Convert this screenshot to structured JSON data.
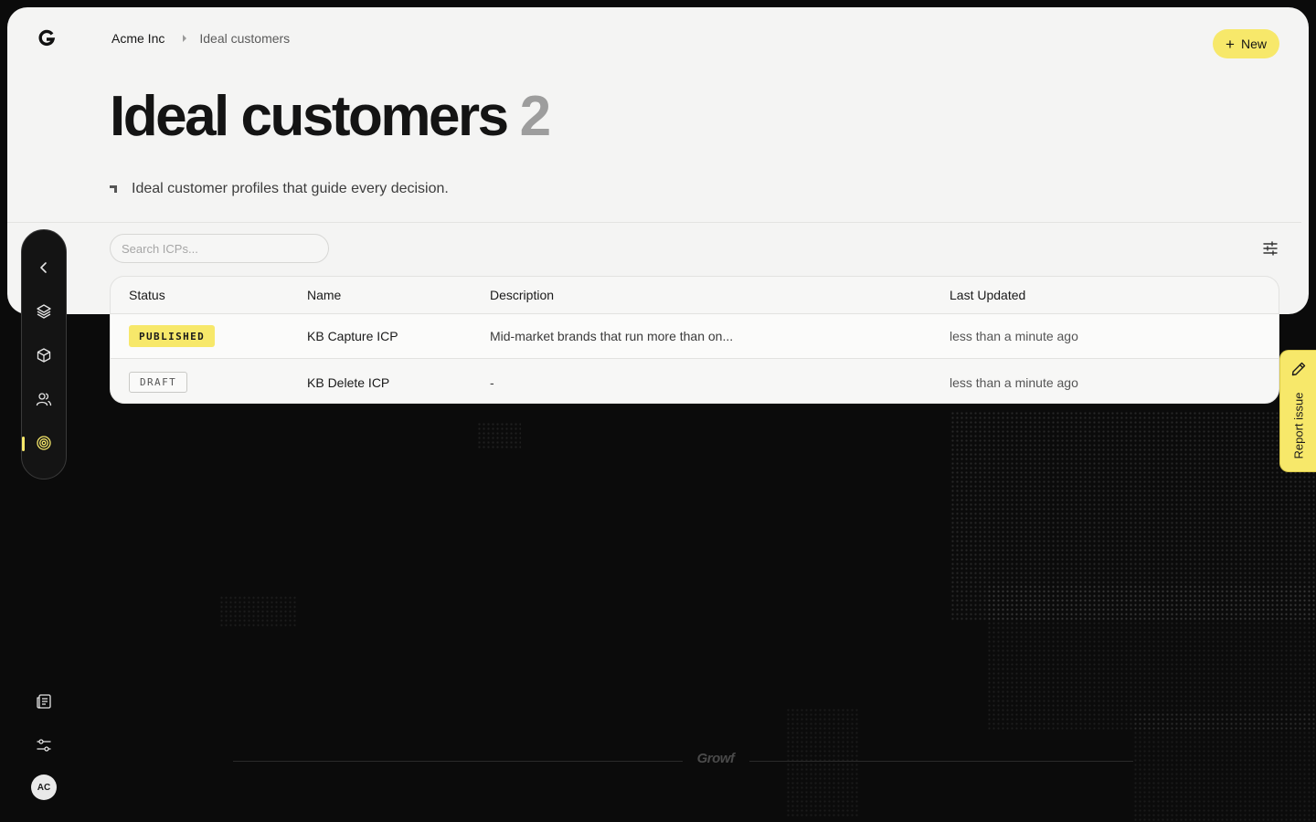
{
  "breadcrumb": {
    "root": "Acme Inc",
    "current": "Ideal customers"
  },
  "header": {
    "new_label": "New",
    "title": "Ideal customers",
    "count": "2",
    "subtitle": "Ideal customer profiles that guide every decision."
  },
  "search": {
    "placeholder": "Search ICPs..."
  },
  "table": {
    "columns": [
      "Status",
      "Name",
      "Description",
      "Last Updated"
    ],
    "rows": [
      {
        "status": "PUBLISHED",
        "name": "KB Capture ICP",
        "description": "Mid-market brands that run more than on...",
        "updated": "less than a minute ago"
      },
      {
        "status": "DRAFT",
        "name": "KB Delete ICP",
        "description": "-",
        "updated": "less than a minute ago"
      }
    ]
  },
  "sidebar": {
    "items": [
      {
        "icon": "chevron-left-icon"
      },
      {
        "icon": "layers-icon"
      },
      {
        "icon": "cube-icon"
      },
      {
        "icon": "users-icon"
      },
      {
        "icon": "target-icon",
        "active": true
      }
    ],
    "bottom": [
      {
        "icon": "docs-icon"
      },
      {
        "icon": "settings-sliders-icon"
      }
    ],
    "avatar": "AC"
  },
  "report": {
    "label": "Report issue"
  },
  "footer": {
    "brand": "Growf"
  },
  "colors": {
    "accent": "#f7e86a",
    "panel": "#f4f4f3",
    "background": "#0b0b0b"
  }
}
